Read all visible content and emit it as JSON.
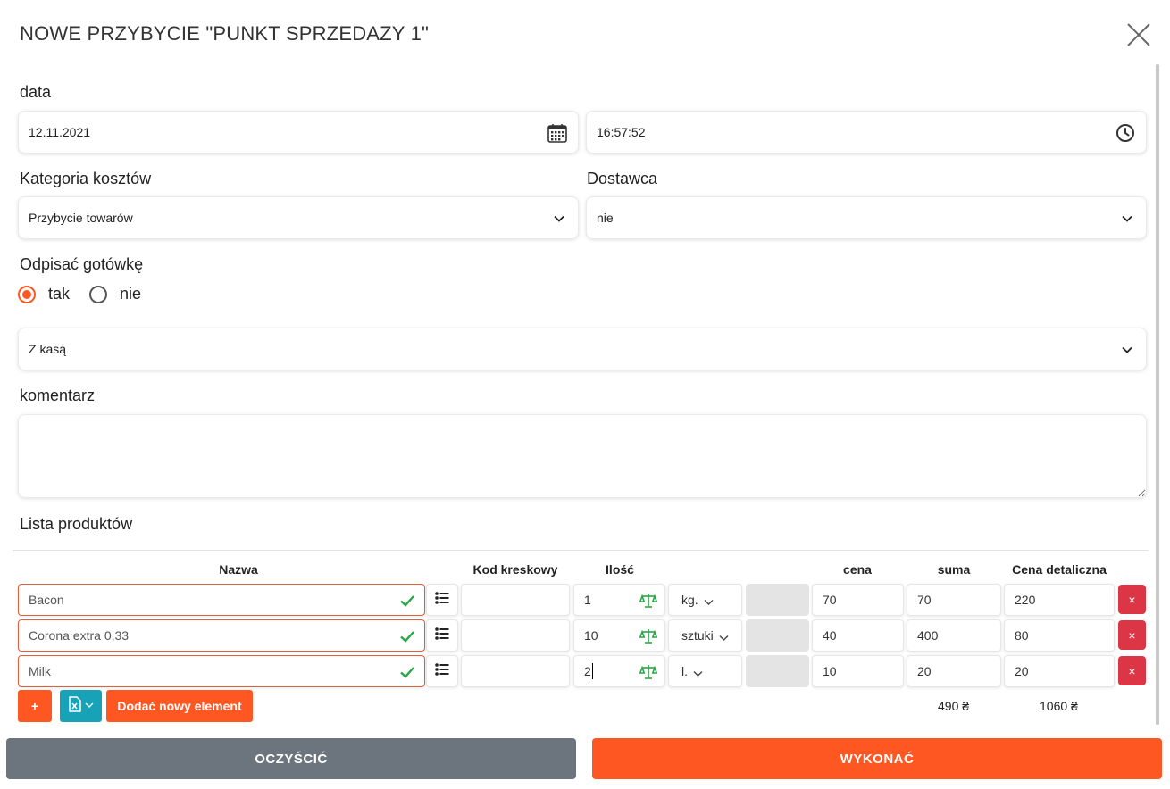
{
  "dialog": {
    "title": "NOWE PRZYBYCIE \"PUNKT SPRZEDAZY 1\""
  },
  "form": {
    "date_label": "data",
    "date_value": "12.11.2021",
    "time_value": "16:57:52",
    "cost_category_label": "Kategoria kosztów",
    "cost_category_value": "Przybycie towarów",
    "supplier_label": "Dostawca",
    "supplier_value": "nie",
    "cash_label": "Odpisać gotówkę",
    "cash_options": [
      {
        "label": "tak",
        "selected": true
      },
      {
        "label": "nie",
        "selected": false
      }
    ],
    "cash_source_value": "Z kasą",
    "comment_label": "komentarz",
    "comment_value": ""
  },
  "products": {
    "section_label": "Lista produktów",
    "headers": {
      "name": "Nazwa",
      "barcode": "Kod kreskowy",
      "quantity": "Ilość",
      "price": "cena",
      "sum": "suma",
      "retail_price": "Cena detaliczna"
    },
    "rows": [
      {
        "name": "Bacon",
        "barcode": "",
        "quantity": "1",
        "unit": "kg.",
        "price": "70",
        "sum": "70",
        "retail_price": "220",
        "delete": "×"
      },
      {
        "name": "Corona extra 0,33",
        "barcode": "",
        "quantity": "10",
        "unit": "sztuki",
        "price": "40",
        "sum": "400",
        "retail_price": "80",
        "delete": "×"
      },
      {
        "name": "Milk",
        "barcode": "",
        "quantity": "2",
        "unit": "l.",
        "price": "10",
        "sum": "20",
        "retail_price": "20",
        "delete": "×"
      }
    ],
    "add_label": "+",
    "add_new_label": "Dodać nowy element",
    "total_sum": "490 ₴",
    "total_retail": "1060 ₴"
  },
  "footer": {
    "clear_label": "OCZYŚCIĆ",
    "submit_label": "WYKONAĆ"
  },
  "colors": {
    "accent": "#ff5722",
    "grey_button": "#6c757d",
    "danger": "#dc3545",
    "teal": "#17a2b8",
    "check": "#28a745"
  }
}
